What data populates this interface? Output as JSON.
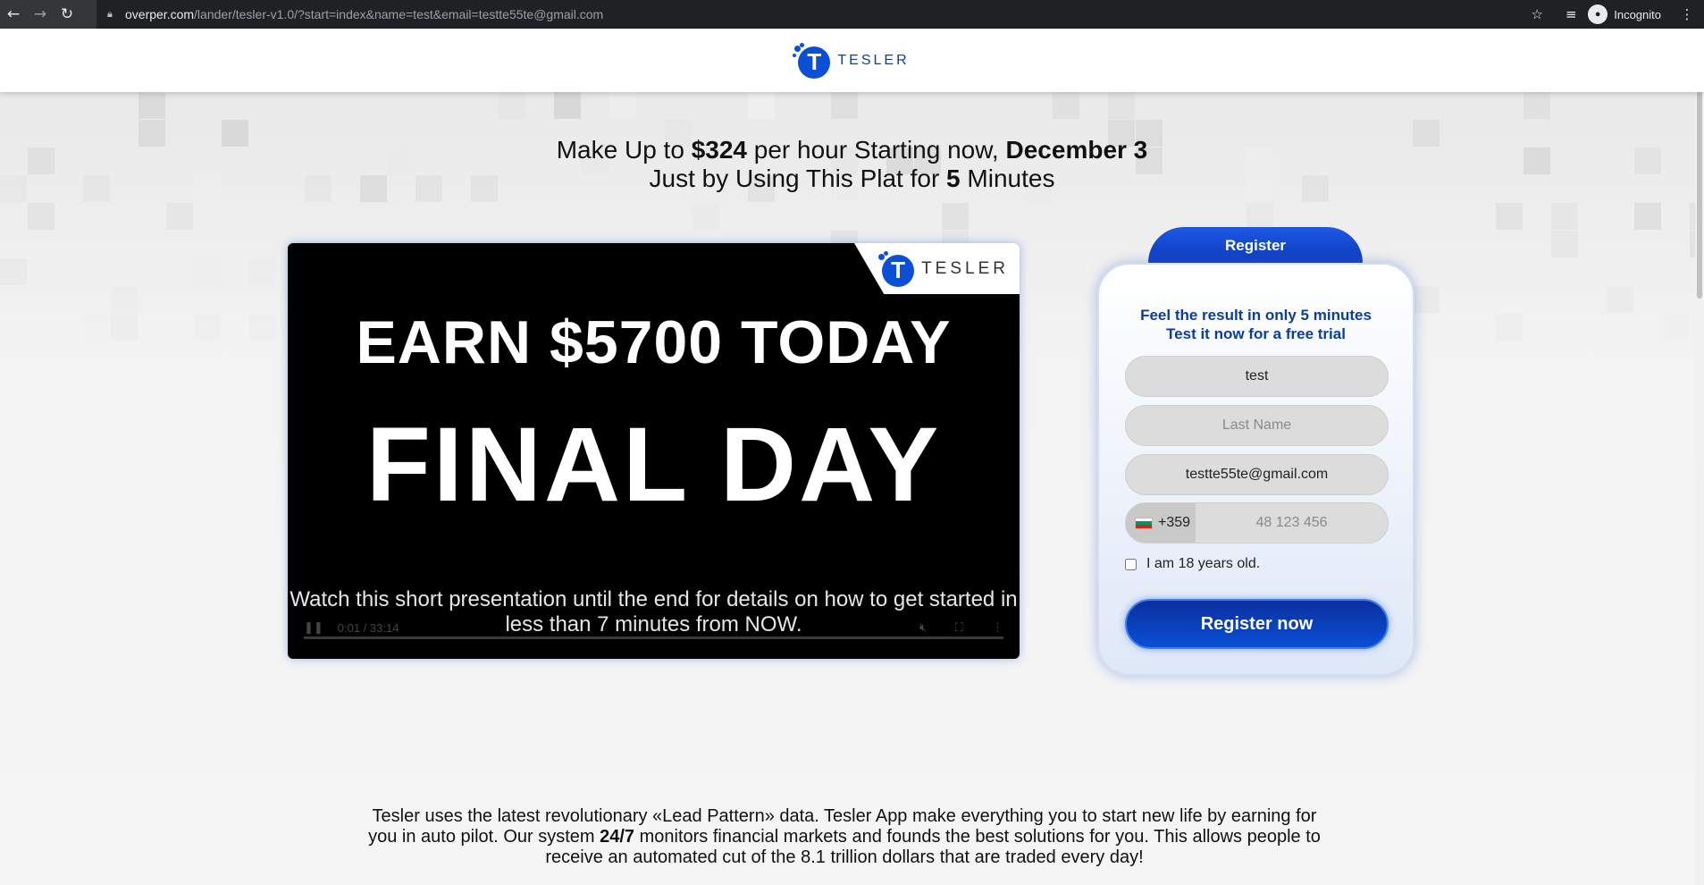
{
  "browser": {
    "url_host": "overper.com",
    "url_path": "/lander/tesler-v1.0/?start=index&name=test&email=testte55te@gmail.com",
    "incognito_label": "Incognito"
  },
  "header": {
    "logo_text": "TESLER",
    "logo_letter": "T"
  },
  "headline": {
    "line1_a": "Make Up to ",
    "line1_amount": "$324",
    "line1_b": " per hour Starting now, ",
    "line1_date": "December 3",
    "line2_a": "Just by Using This Plat for ",
    "line2_num": "5",
    "line2_b": " Minutes"
  },
  "video": {
    "logo_text": "TESLER",
    "line1": "EARN $5700 TODAY",
    "line2": "FINAL DAY",
    "caption": "Watch this short presentation until the end for details on how to get started in less than 7 minutes from NOW.",
    "time": "0:01 / 33:14"
  },
  "form": {
    "tab_label": "Register",
    "title_line1": "Feel the result in only 5 minutes",
    "title_line2": "Test it now for a free trial",
    "first_name_value": "test",
    "last_name_placeholder": "Last Name",
    "email_value": "testte55te@gmail.com",
    "phone_prefix": "+359",
    "phone_placeholder": "48 123 456",
    "age_label": "I am 18 years old.",
    "submit_label": "Register now"
  },
  "bottom_text": {
    "p1": "Tesler uses the latest revolutionary «Lead Pattern» data. Tesler App make everything you to start new life by earning for you in auto pilot. Our system ",
    "bold": "24/7",
    "p2": " monitors financial markets and founds the best solutions for you. This allows people to receive an automated cut of the 8.1 trillion dollars that are traded every day!"
  },
  "colors": {
    "brand_blue": "#0a4fd6",
    "form_title_blue": "#0b3e9c"
  }
}
